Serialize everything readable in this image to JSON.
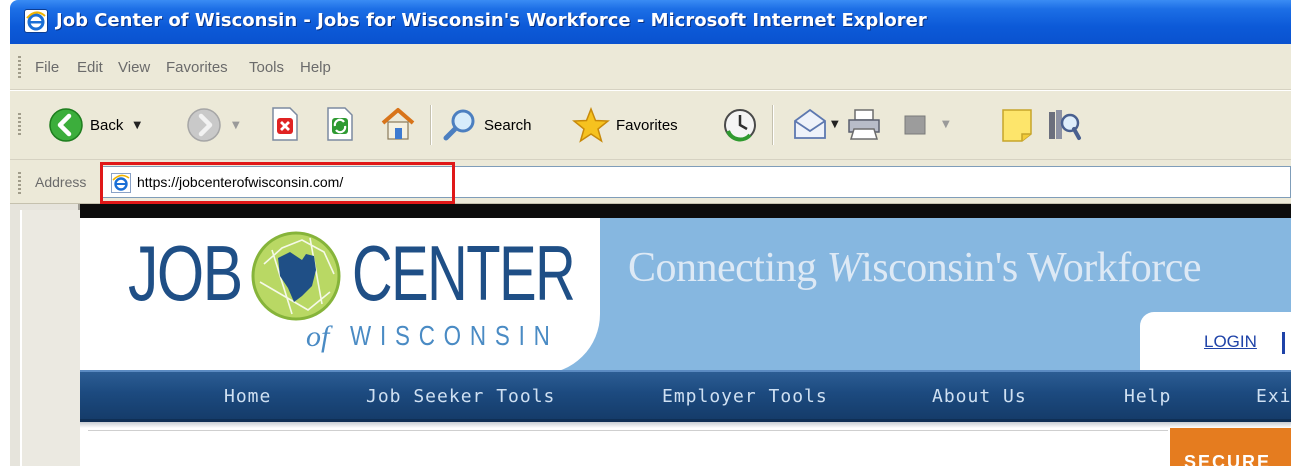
{
  "window": {
    "title": "Job Center of Wisconsin - Jobs for Wisconsin's Workforce - Microsoft Internet Explorer"
  },
  "menubar": {
    "items": [
      "File",
      "Edit",
      "View",
      "Favorites",
      "Tools",
      "Help"
    ]
  },
  "toolbar": {
    "back_label": "Back",
    "search_label": "Search",
    "favorites_label": "Favorites",
    "icons": [
      "back-icon",
      "forward-icon",
      "stop-icon",
      "refresh-icon",
      "home-icon",
      "search-icon",
      "favorites-star-icon",
      "history-icon",
      "mail-icon",
      "print-icon",
      "edit-icon",
      "discuss-icon",
      "research-icon"
    ]
  },
  "addressbar": {
    "label": "Address",
    "url": "https://jobcenterofwisconsin.com/",
    "highlight_color": "#e01818"
  },
  "site": {
    "logo": {
      "job": "JOB",
      "center": "CENTER",
      "of": "of",
      "wisconsin": "WISCONSIN"
    },
    "tagline_prefix": "Connecting ",
    "tagline_italic": "W",
    "tagline_suffix": "isconsin's Workforce",
    "login_label": "LOGIN",
    "nav": [
      "Home",
      "Job Seeker Tools",
      "Employer Tools",
      "About Us",
      "Help",
      "Exi"
    ],
    "secure_label": "SECURE",
    "colors": {
      "brand_dark": "#1f4f86",
      "banner_blue": "#86b7e0",
      "nav_blue": "#1c4a7f",
      "accent_orange": "#e57c1f"
    }
  }
}
